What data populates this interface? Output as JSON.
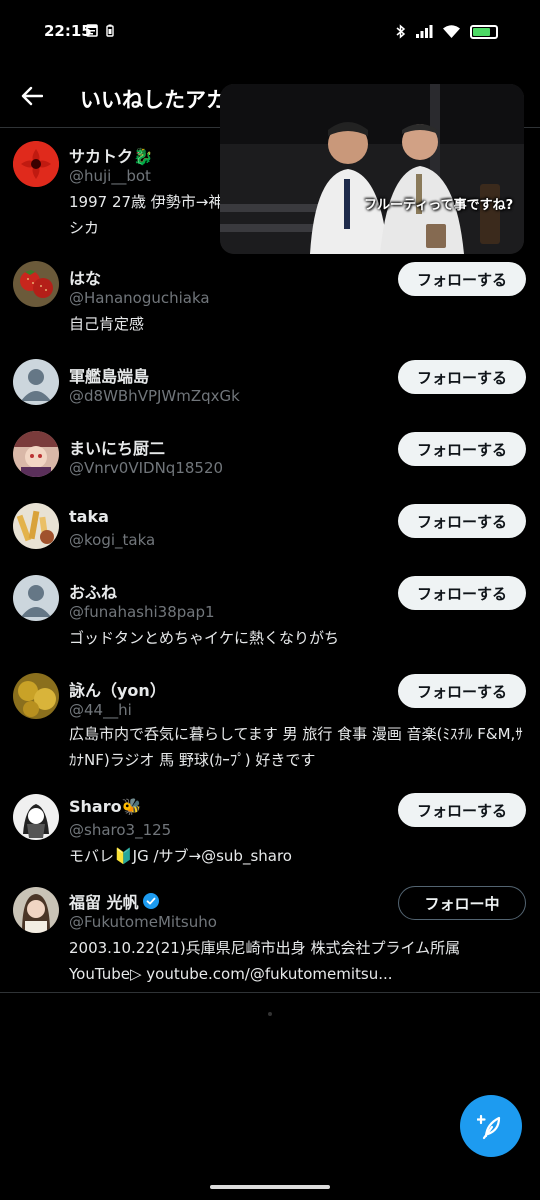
{
  "status_bar": {
    "time": "22:15",
    "battery_level": 0.75,
    "battery_color": "#4cd964"
  },
  "header": {
    "title": "いいねしたアカウント",
    "back_icon": "arrow-left-icon"
  },
  "video_overlay": {
    "caption": "フルーティって事ですね?"
  },
  "users": [
    {
      "name": "サカトク🐉",
      "handle": "@huji__bot",
      "bio": "1997 27歳 伊勢市→神戸 ヨルシカ",
      "button": ""
    },
    {
      "name": "はな",
      "handle": "@Hananoguchiaka",
      "bio": "自己肯定感",
      "button": "フォローする"
    },
    {
      "name": "軍艦島端島",
      "handle": "@d8WBhVPJWmZqxGk",
      "bio": "",
      "button": "フォローする"
    },
    {
      "name": "まいにち厨二",
      "handle": "@Vnrv0VIDNq18520",
      "bio": "",
      "button": "フォローする"
    },
    {
      "name": "taka",
      "handle": "@kogi_taka",
      "bio": "",
      "button": "フォローする"
    },
    {
      "name": "おふね",
      "handle": "@funahashi38pap1",
      "bio": "ゴッドタンとめちゃイケに熱くなりがち",
      "button": "フォローする"
    },
    {
      "name": "詠ん（yon）",
      "handle": "@44__hi",
      "bio": "広島市内で呑気に暮らしてます 男 旅行 食事 漫画 音楽(ﾐｽﾁﾙ F&M,ｻｶﾅNF)ラジオ 馬 野球(ｶｰﾌﾟ) 好きです",
      "button": "フォローする"
    },
    {
      "name": "Sharo🐝",
      "handle": "@sharo3_125",
      "bio": "モバレ🔰JG /サブ→@sub_sharo",
      "button": "フォローする"
    },
    {
      "name": "福留 光帆",
      "handle": "@FukutomeMitsuho",
      "bio": "2003.10.22(21)兵庫県尼崎市出身 株式会社プライム所属 YouTube▷ youtube.com/@fukutomemitsu...",
      "button": "フォロー中",
      "verified": true
    }
  ],
  "fab": {
    "icon": "compose-plus-icon",
    "color": "#1d9bf0"
  }
}
